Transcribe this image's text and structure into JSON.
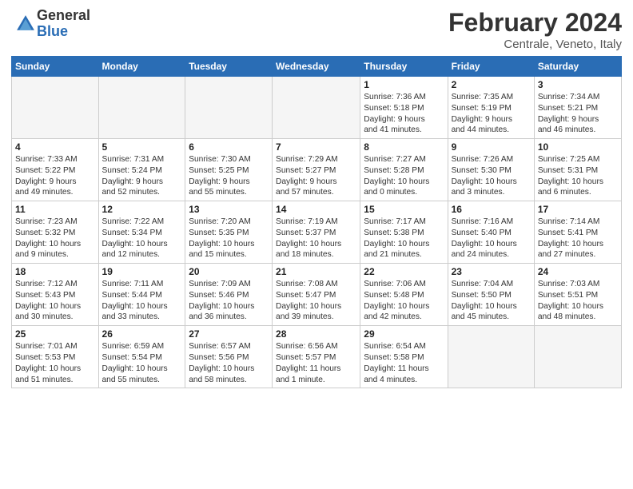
{
  "header": {
    "logo_general": "General",
    "logo_blue": "Blue",
    "month": "February 2024",
    "location": "Centrale, Veneto, Italy"
  },
  "weekdays": [
    "Sunday",
    "Monday",
    "Tuesday",
    "Wednesday",
    "Thursday",
    "Friday",
    "Saturday"
  ],
  "weeks": [
    [
      {
        "day": "",
        "info": ""
      },
      {
        "day": "",
        "info": ""
      },
      {
        "day": "",
        "info": ""
      },
      {
        "day": "",
        "info": ""
      },
      {
        "day": "1",
        "info": "Sunrise: 7:36 AM\nSunset: 5:18 PM\nDaylight: 9 hours\nand 41 minutes."
      },
      {
        "day": "2",
        "info": "Sunrise: 7:35 AM\nSunset: 5:19 PM\nDaylight: 9 hours\nand 44 minutes."
      },
      {
        "day": "3",
        "info": "Sunrise: 7:34 AM\nSunset: 5:21 PM\nDaylight: 9 hours\nand 46 minutes."
      }
    ],
    [
      {
        "day": "4",
        "info": "Sunrise: 7:33 AM\nSunset: 5:22 PM\nDaylight: 9 hours\nand 49 minutes."
      },
      {
        "day": "5",
        "info": "Sunrise: 7:31 AM\nSunset: 5:24 PM\nDaylight: 9 hours\nand 52 minutes."
      },
      {
        "day": "6",
        "info": "Sunrise: 7:30 AM\nSunset: 5:25 PM\nDaylight: 9 hours\nand 55 minutes."
      },
      {
        "day": "7",
        "info": "Sunrise: 7:29 AM\nSunset: 5:27 PM\nDaylight: 9 hours\nand 57 minutes."
      },
      {
        "day": "8",
        "info": "Sunrise: 7:27 AM\nSunset: 5:28 PM\nDaylight: 10 hours\nand 0 minutes."
      },
      {
        "day": "9",
        "info": "Sunrise: 7:26 AM\nSunset: 5:30 PM\nDaylight: 10 hours\nand 3 minutes."
      },
      {
        "day": "10",
        "info": "Sunrise: 7:25 AM\nSunset: 5:31 PM\nDaylight: 10 hours\nand 6 minutes."
      }
    ],
    [
      {
        "day": "11",
        "info": "Sunrise: 7:23 AM\nSunset: 5:32 PM\nDaylight: 10 hours\nand 9 minutes."
      },
      {
        "day": "12",
        "info": "Sunrise: 7:22 AM\nSunset: 5:34 PM\nDaylight: 10 hours\nand 12 minutes."
      },
      {
        "day": "13",
        "info": "Sunrise: 7:20 AM\nSunset: 5:35 PM\nDaylight: 10 hours\nand 15 minutes."
      },
      {
        "day": "14",
        "info": "Sunrise: 7:19 AM\nSunset: 5:37 PM\nDaylight: 10 hours\nand 18 minutes."
      },
      {
        "day": "15",
        "info": "Sunrise: 7:17 AM\nSunset: 5:38 PM\nDaylight: 10 hours\nand 21 minutes."
      },
      {
        "day": "16",
        "info": "Sunrise: 7:16 AM\nSunset: 5:40 PM\nDaylight: 10 hours\nand 24 minutes."
      },
      {
        "day": "17",
        "info": "Sunrise: 7:14 AM\nSunset: 5:41 PM\nDaylight: 10 hours\nand 27 minutes."
      }
    ],
    [
      {
        "day": "18",
        "info": "Sunrise: 7:12 AM\nSunset: 5:43 PM\nDaylight: 10 hours\nand 30 minutes."
      },
      {
        "day": "19",
        "info": "Sunrise: 7:11 AM\nSunset: 5:44 PM\nDaylight: 10 hours\nand 33 minutes."
      },
      {
        "day": "20",
        "info": "Sunrise: 7:09 AM\nSunset: 5:46 PM\nDaylight: 10 hours\nand 36 minutes."
      },
      {
        "day": "21",
        "info": "Sunrise: 7:08 AM\nSunset: 5:47 PM\nDaylight: 10 hours\nand 39 minutes."
      },
      {
        "day": "22",
        "info": "Sunrise: 7:06 AM\nSunset: 5:48 PM\nDaylight: 10 hours\nand 42 minutes."
      },
      {
        "day": "23",
        "info": "Sunrise: 7:04 AM\nSunset: 5:50 PM\nDaylight: 10 hours\nand 45 minutes."
      },
      {
        "day": "24",
        "info": "Sunrise: 7:03 AM\nSunset: 5:51 PM\nDaylight: 10 hours\nand 48 minutes."
      }
    ],
    [
      {
        "day": "25",
        "info": "Sunrise: 7:01 AM\nSunset: 5:53 PM\nDaylight: 10 hours\nand 51 minutes."
      },
      {
        "day": "26",
        "info": "Sunrise: 6:59 AM\nSunset: 5:54 PM\nDaylight: 10 hours\nand 55 minutes."
      },
      {
        "day": "27",
        "info": "Sunrise: 6:57 AM\nSunset: 5:56 PM\nDaylight: 10 hours\nand 58 minutes."
      },
      {
        "day": "28",
        "info": "Sunrise: 6:56 AM\nSunset: 5:57 PM\nDaylight: 11 hours\nand 1 minute."
      },
      {
        "day": "29",
        "info": "Sunrise: 6:54 AM\nSunset: 5:58 PM\nDaylight: 11 hours\nand 4 minutes."
      },
      {
        "day": "",
        "info": ""
      },
      {
        "day": "",
        "info": ""
      }
    ]
  ]
}
